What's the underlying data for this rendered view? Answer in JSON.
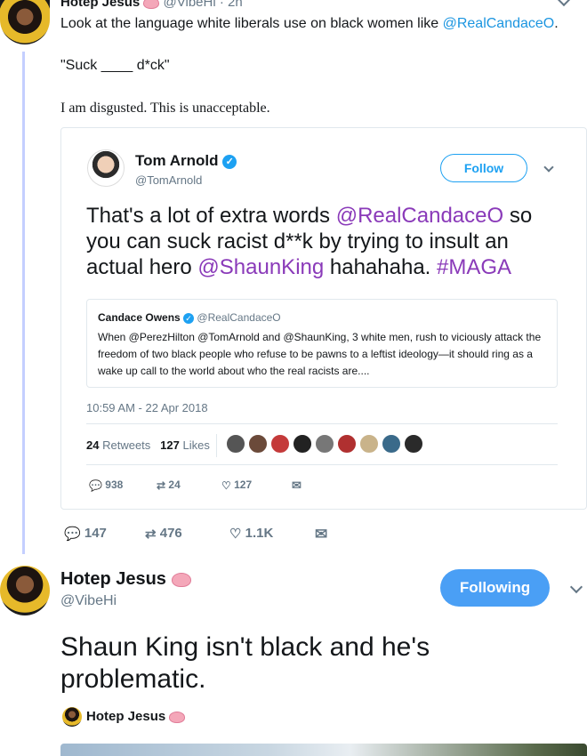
{
  "top_tweet": {
    "name": "Hotep Jesus",
    "handle_time": "@VibeHi · 2h",
    "line1": "Look at the language white liberals use on black women like ",
    "line1_mention": "@RealCandaceO",
    "line1_end": ".",
    "line2": "\"Suck ____ d*ck\"",
    "line3": "I am disgusted. This is unacceptable.",
    "actions": {
      "replies": "147",
      "retweets": "476",
      "likes": "1.1K"
    }
  },
  "embedded_tweet": {
    "name": "Tom Arnold",
    "handle": "@TomArnold",
    "follow_label": "Follow",
    "text_a": "That's a lot of extra words ",
    "mention1": "@RealCandaceO",
    "text_b": " so you can suck racist d**k by trying to insult an actual hero ",
    "mention2": "@ShaunKing",
    "text_c": " hahahaha. ",
    "hashtag": "#MAGA",
    "timestamp": "10:59 AM - 22 Apr 2018",
    "retweets_count": "24",
    "retweets_label": "Retweets",
    "likes_count": "127",
    "likes_label": "Likes",
    "actions": {
      "replies": "938",
      "retweets": "24",
      "likes": "127"
    },
    "quote": {
      "name": "Candace Owens",
      "handle": "@RealCandaceO",
      "text": "When @PerezHilton @TomArnold and @ShaunKing, 3 white men, rush to viciously attack the freedom of two black people who refuse to be pawns to a leftist ideology—it should ring as a wake up call to the world about who the real racists are...."
    }
  },
  "reply_tweet": {
    "name": "Hotep Jesus",
    "handle": "@VibeHi",
    "following_label": "Following",
    "text": "Shaun King isn't black and he's problematic.",
    "embedded_name": "Hotep Jesus"
  },
  "colors": {
    "link": "#1b95e0",
    "purple": "#8a3ab9",
    "following": "#4a9ff5",
    "thread": "#c4cfff"
  }
}
